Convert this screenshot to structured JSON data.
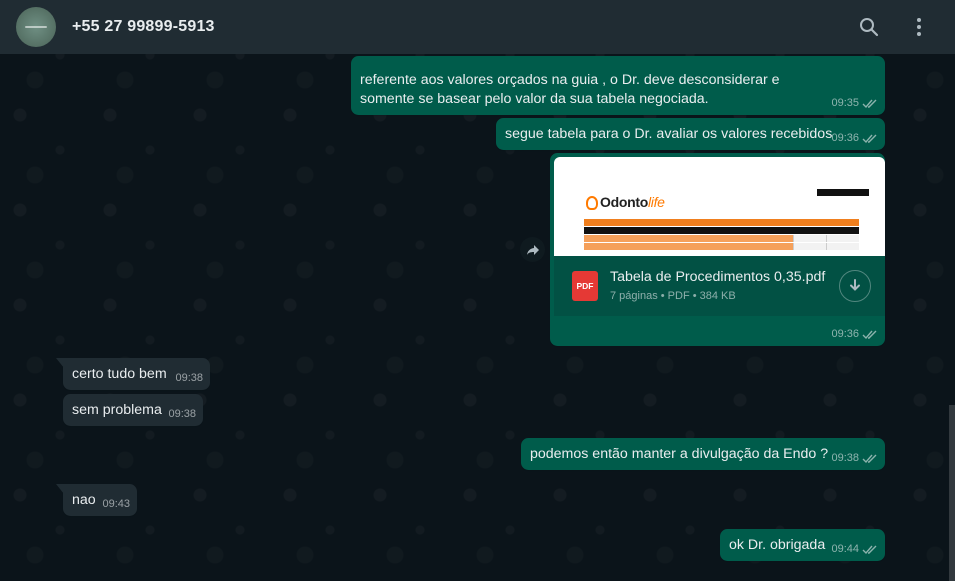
{
  "header": {
    "contact_name": "+55 27 99899-5913"
  },
  "messages": [
    {
      "dir": "out",
      "text": "referente aos valores orçados na guia , o Dr. deve desconsiderar e somente se basear pelo valor da sua tabela negociada.",
      "time": "09:35"
    },
    {
      "dir": "out",
      "text": "segue tabela para o Dr. avaliar os valores recebidos",
      "time": "09:36"
    },
    {
      "dir": "out",
      "type": "document",
      "file_name": "Tabela de Procedimentos 0,35.pdf",
      "file_meta": "7 páginas • PDF • 384 KB",
      "icon_label": "PDF",
      "time": "09:36"
    },
    {
      "dir": "in",
      "text": "certo tudo bem",
      "time": "09:38"
    },
    {
      "dir": "in",
      "text": "sem problema",
      "time": "09:38"
    },
    {
      "dir": "out",
      "text": "podemos então manter a divulgação da Endo ?",
      "time": "09:38"
    },
    {
      "dir": "in",
      "text": "nao",
      "time": "09:43"
    },
    {
      "dir": "out",
      "text": "ok Dr. obrigada",
      "time": "09:44"
    }
  ],
  "icons": {
    "search": "search-icon",
    "menu": "more-vertical-icon",
    "ticks": "double-check-icon",
    "download": "download-icon",
    "forward": "forward-icon",
    "pdf": "pdf-file-icon"
  },
  "colors": {
    "header_bg": "#202c33",
    "chat_bg": "#0b141a",
    "outgoing_bubble": "#005c4b",
    "incoming_bubble": "#202c33",
    "text": "#e9edef",
    "pdf_red": "#e53935"
  }
}
